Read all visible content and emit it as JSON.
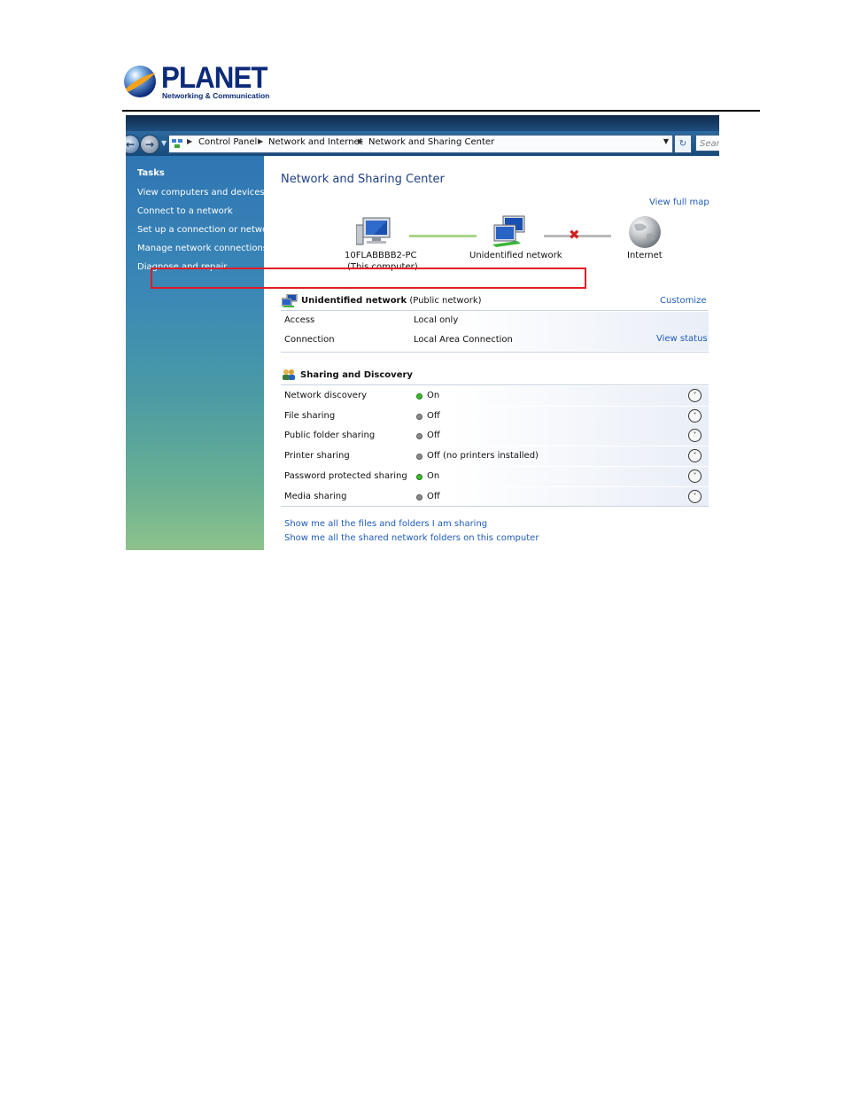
{
  "header": {
    "logo_name": "PLANET",
    "logo_tagline": "Networking & Communication"
  },
  "address_bar": {
    "crumbs": [
      "Control Panel",
      "Network and Internet",
      "Network and Sharing Center"
    ],
    "search_placeholder": "Search"
  },
  "sidebar": {
    "title": "Tasks",
    "items": [
      "View computers and devices",
      "Connect to a network",
      "Set up a connection or network",
      "Manage network connections",
      "Diagnose and repair"
    ]
  },
  "main": {
    "title": "Network and Sharing Center",
    "view_full_map": "View full map",
    "map": {
      "computer_name": "10FLABBBB2-PC",
      "computer_sub": "(This computer)",
      "network_name": "Unidentified network",
      "internet_label": "Internet"
    },
    "network": {
      "name": "Unidentified network",
      "type": "(Public network)",
      "customize": "Customize",
      "access_label": "Access",
      "access_value": "Local only",
      "connection_label": "Connection",
      "connection_value": "Local Area Connection",
      "view_status": "View status"
    },
    "sharing": {
      "title": "Sharing and Discovery",
      "rows": [
        {
          "label": "Network discovery",
          "status": "On",
          "state": "on"
        },
        {
          "label": "File sharing",
          "status": "Off",
          "state": "off"
        },
        {
          "label": "Public folder sharing",
          "status": "Off",
          "state": "off"
        },
        {
          "label": "Printer sharing",
          "status": "Off (no printers installed)",
          "state": "off"
        },
        {
          "label": "Password protected sharing",
          "status": "On",
          "state": "on"
        },
        {
          "label": "Media sharing",
          "status": "Off",
          "state": "off"
        }
      ]
    },
    "links": {
      "show_files": "Show me all the files and folders I am sharing",
      "show_folders": "Show me all the shared network folders on this computer"
    }
  },
  "colors": {
    "highlight": "#e21b23",
    "status_on": "#3dbb2f",
    "status_off": "#8a8a8a",
    "link": "#1f5cb8",
    "title": "#1e3f84"
  }
}
